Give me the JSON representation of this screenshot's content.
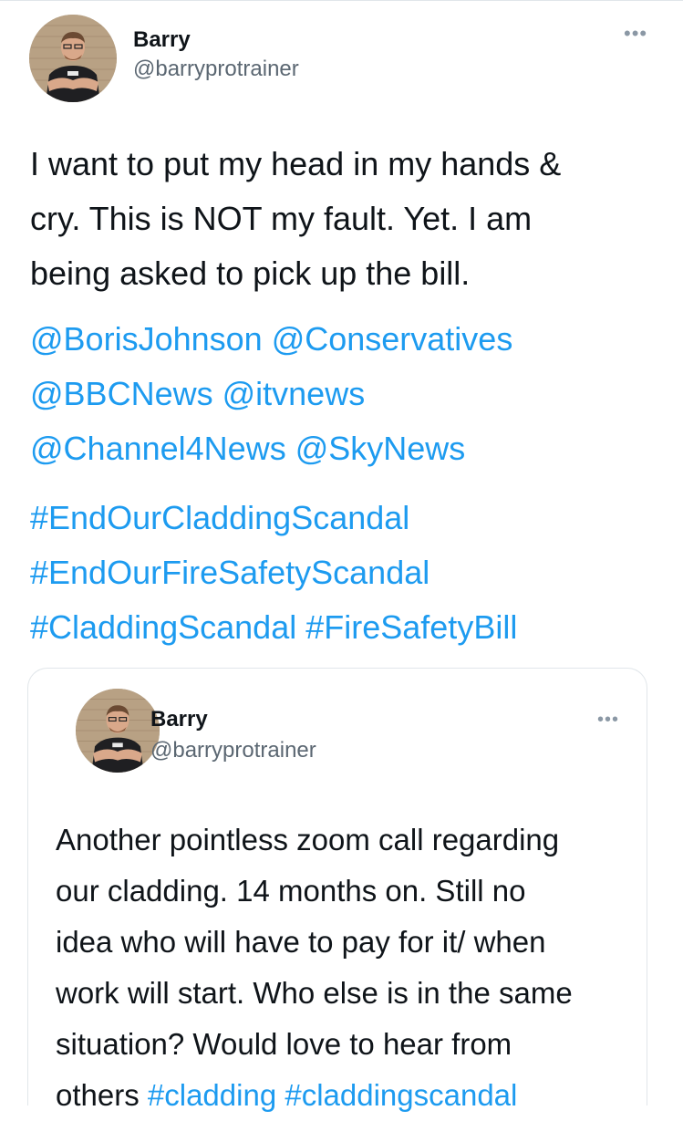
{
  "tweet": {
    "author": {
      "name": "Barry",
      "handle": "@barryprotrainer"
    },
    "more_label": "•••",
    "text_lines": [
      "I want to put my head in my hands &",
      "cry. This is NOT my fault. Yet. I am",
      "being asked to pick up the bill."
    ],
    "mentions": [
      "@BorisJohnson",
      "@Conservatives",
      "@BBCNews",
      "@itvnews",
      "@Channel4News",
      "@SkyNews"
    ],
    "hashtags": [
      "#EndOurCladdingScandal",
      "#EndOurFireSafetyScandal",
      "#CladdingScandal",
      "#FireSafetyBill"
    ]
  },
  "quoted_tweet": {
    "author": {
      "name": "Barry",
      "handle": "@barryprotrainer"
    },
    "more_label": "•••",
    "text_lines": [
      "Another pointless zoom call regarding",
      "our cladding. 14 months on. Still no",
      "idea who will have to pay for it/ when",
      "work will start. Who else is in the same",
      "situation? Would love to hear from"
    ],
    "last_line_text": "others",
    "hashtags": [
      "#cladding",
      "#claddingscandal"
    ]
  }
}
